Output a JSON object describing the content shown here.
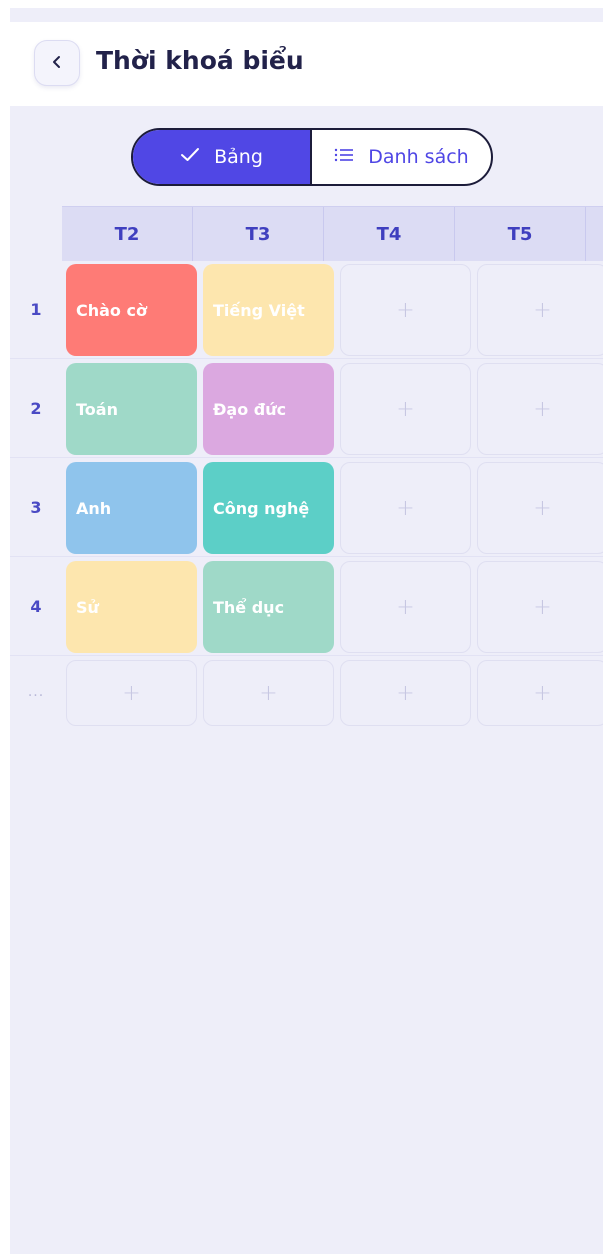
{
  "header": {
    "title": "Thời khoá biểu"
  },
  "view_toggle": {
    "table_label": "Bảng",
    "list_label": "Danh sách",
    "selected": "Bảng"
  },
  "timetable": {
    "days": [
      "T2",
      "T3",
      "T4",
      "T5"
    ],
    "rows": [
      {
        "label": "1",
        "cells": [
          {
            "subject": "Chào cờ",
            "color": "#fe7b76"
          },
          {
            "subject": "Tiếng Việt",
            "color": "#fde6ae"
          },
          {
            "subject": "",
            "add": "+"
          },
          {
            "subject": "",
            "add": "+"
          }
        ]
      },
      {
        "label": "2",
        "cells": [
          {
            "subject": "Toán",
            "color": "#9fd9c8"
          },
          {
            "subject": "Đạo đức",
            "color": "#dba8e0"
          },
          {
            "subject": "",
            "add": "+"
          },
          {
            "subject": "",
            "add": "+"
          }
        ]
      },
      {
        "label": "3",
        "cells": [
          {
            "subject": "Anh",
            "color": "#8fc4ec"
          },
          {
            "subject": "Công nghệ",
            "color": "#5ccfc7"
          },
          {
            "subject": "",
            "add": "+"
          },
          {
            "subject": "",
            "add": "+"
          }
        ]
      },
      {
        "label": "4",
        "cells": [
          {
            "subject": "Sử",
            "color": "#fde6ae"
          },
          {
            "subject": "Thể dục",
            "color": "#9fd9c8"
          },
          {
            "subject": "",
            "add": "+"
          },
          {
            "subject": "",
            "add": "+"
          }
        ]
      },
      {
        "label": "...",
        "cells": [
          {
            "subject": "",
            "add": "+"
          },
          {
            "subject": "",
            "add": "+"
          },
          {
            "subject": "",
            "add": "+"
          },
          {
            "subject": "",
            "add": "+"
          }
        ]
      }
    ]
  },
  "icons": {
    "back": "chevron-left-icon",
    "table": "checkmark-icon",
    "list": "list-icon"
  }
}
